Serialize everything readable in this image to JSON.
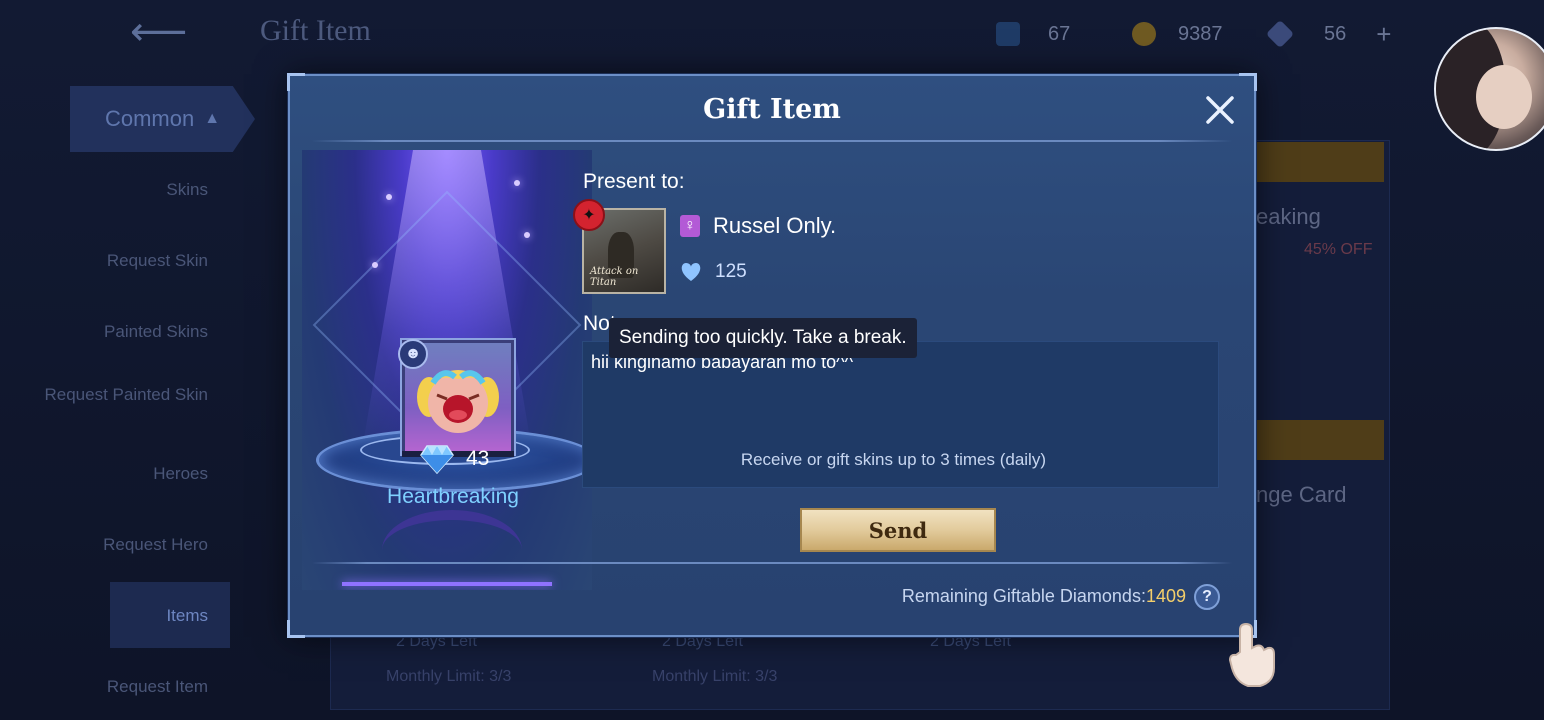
{
  "background": {
    "title": "Gift Item",
    "resources": [
      {
        "icon": "m-card-icon",
        "value": "67"
      },
      {
        "icon": "gold-coin-icon",
        "value": "9387"
      },
      {
        "icon": "diamond-icon",
        "value": "56"
      }
    ],
    "category": "Common",
    "sidebar": [
      "Skins",
      "Request Skin",
      "Painted Skins",
      "Request Painted Skin",
      "Heroes",
      "Request Hero",
      "Items",
      "Request Item"
    ],
    "right_texts": [
      "eaking",
      "45% OFF",
      "nge Card"
    ],
    "days_left": "2 Days Left",
    "monthly_limit": "Monthly Limit: 3/3"
  },
  "modal": {
    "title": "Gift Item",
    "item": {
      "name": "Heartbreaking",
      "price": "43"
    },
    "present_label": "Present to:",
    "recipient": {
      "name": "Russel Only.",
      "likes": "125",
      "avatar_text": "Attack on Titan"
    },
    "note_label": "Note:",
    "note_text": "hii kinginamo babayaran mo to^^",
    "note_hint": "Receive or gift skins up to 3 times (daily)",
    "toast": "Sending too quickly. Take a break.",
    "send_label": "Send",
    "remaining_label": "Remaining Giftable Diamonds:",
    "remaining_value": "1409",
    "help_label": "?"
  },
  "colors": {
    "modal_bg": "#2a4674",
    "accent_gold": "#f4cf6a",
    "item_name": "#7fd1ff"
  }
}
